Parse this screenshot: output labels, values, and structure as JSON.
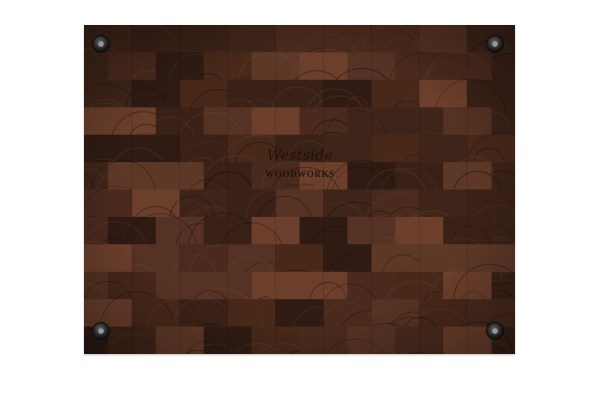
{
  "product": {
    "brand_script": "Westside",
    "brand_block": "WOODWORKS",
    "brand_tag": "Calgary Alberta"
  },
  "colors": {
    "background": "#ffffff",
    "wood_dark": "#3b2218",
    "wood_mid": "#5a3526",
    "wood_light": "#7a4a33",
    "foot": "#2a2a2a"
  },
  "icons": [
    "rubber-foot-icon"
  ]
}
